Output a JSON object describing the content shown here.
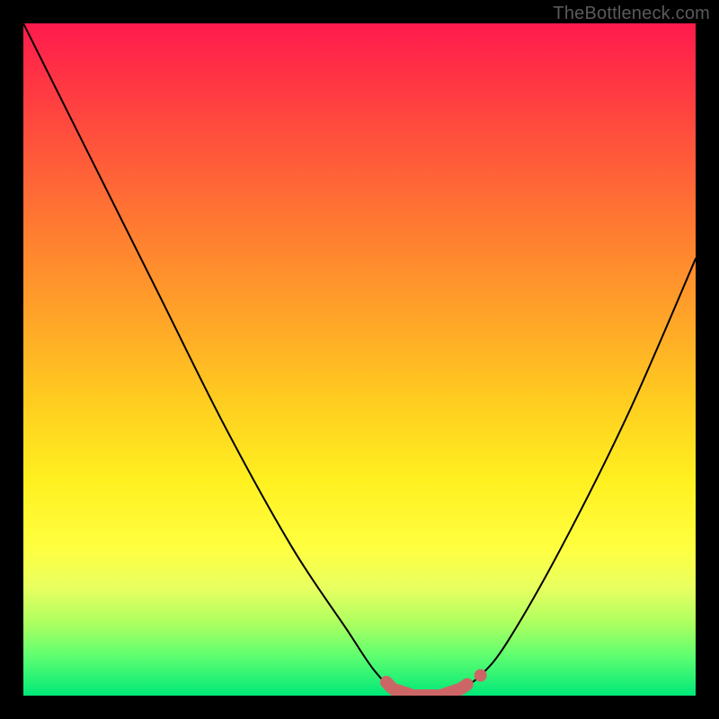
{
  "watermark": "TheBottleneck.com",
  "chart_data": {
    "type": "line",
    "title": "",
    "xlabel": "",
    "ylabel": "",
    "xlim": [
      0,
      100
    ],
    "ylim": [
      0,
      100
    ],
    "series": [
      {
        "name": "bottleneck-curve",
        "x": [
          0,
          10,
          20,
          30,
          40,
          48,
          52,
          55,
          58,
          62,
          65,
          68,
          72,
          80,
          90,
          100
        ],
        "values": [
          100,
          80,
          60,
          40,
          22,
          10,
          4,
          1,
          0,
          0,
          1,
          3,
          8,
          22,
          42,
          65
        ]
      }
    ],
    "highlight": {
      "name": "optimal-zone",
      "x_range": [
        54,
        66
      ],
      "color": "#cc6666"
    },
    "gradient_bg": {
      "top": "#ff1a4d",
      "bottom": "#00e878"
    }
  }
}
